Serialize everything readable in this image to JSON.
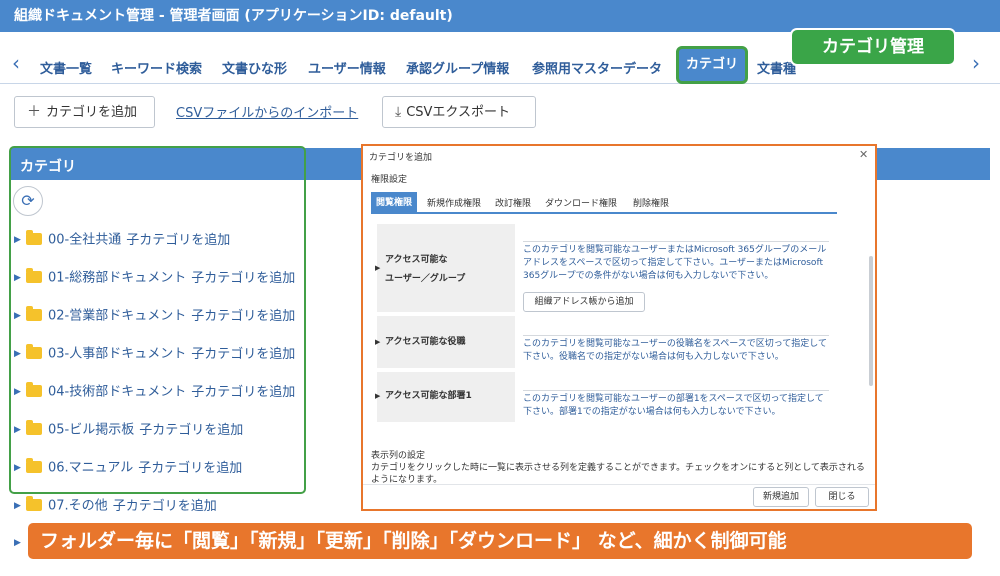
{
  "app": {
    "title": "組織ドキュメント管理 - 管理者画面 (アプリケーションID: default)"
  },
  "nav": {
    "tabs": [
      "文書一覧",
      "キーワード検索",
      "文書ひな形",
      "ユーザー情報",
      "承認グループ情報",
      "参照用マスターデータ"
    ],
    "active_tab": "カテゴリ",
    "partial_tab": "文書種"
  },
  "callouts": {
    "category_management": "カテゴリ管理",
    "permissions_note": "フォルダー毎に「閲覧」「新規」「更新」「削除」「ダウンロード」 など、細かく制御可能"
  },
  "toolbar": {
    "add_category": "カテゴリを追加",
    "import_csv": "CSVファイルからのインポート",
    "export_csv": "CSVエクスポート"
  },
  "panel": {
    "title": "カテゴリ"
  },
  "tree": {
    "add_child_label": "子カテゴリを追加",
    "items": [
      "00-全社共通",
      "01-総務部ドキュメント",
      "02-営業部ドキュメント",
      "03-人事部ドキュメント",
      "04-技術部ドキュメント",
      "05-ビル掲示板",
      "06.マニュアル",
      "07.その他"
    ]
  },
  "dialog": {
    "title": "カテゴリを追加",
    "section": "権限設定",
    "tabs": [
      "閲覧権限",
      "新規作成権限",
      "改訂権限",
      "ダウンロード権限",
      "削除権限"
    ],
    "rows": [
      {
        "label_line1": "アクセス可能な",
        "label_line2": "ユーザー／グループ",
        "desc": "このカテゴリを閲覧可能なユーザーまたはMicrosoft 365グループのメールアドレスをスペースで区切って指定して下さい。ユーザーまたはMicrosoft 365グループでの条件がない場合は何も入力しないで下さい。",
        "button": "組織アドレス帳から追加"
      },
      {
        "label_line1": "アクセス可能な役職",
        "desc": "このカテゴリを閲覧可能なユーザーの役職名をスペースで区切って指定して下さい。役職名での指定がない場合は何も入力しないで下さい。"
      },
      {
        "label_line1": "アクセス可能な部署1",
        "desc": "このカテゴリを閲覧可能なユーザーの部署1をスペースで区切って指定して下さい。部署1での指定がない場合は何も入力しないで下さい。"
      }
    ],
    "display_title": "表示列の設定",
    "display_desc": "カテゴリをクリックした時に一覧に表示させる列を定義することができます。チェックをオンにすると列として表示されるようになります。",
    "add_button": "新規追加",
    "close_button": "閉じる"
  }
}
